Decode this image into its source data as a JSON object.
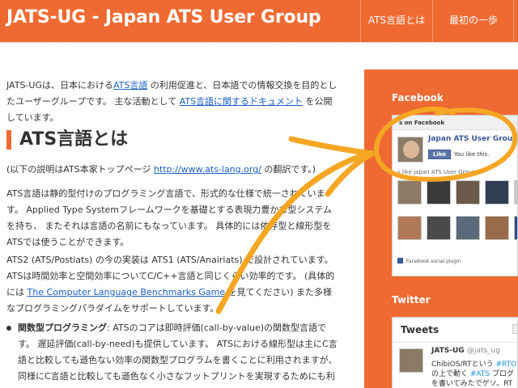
{
  "header": {
    "site_title": "JATS-UG - Japan ATS User Group",
    "nav": [
      {
        "label": "ATS言語とは"
      },
      {
        "label": "最初の一歩"
      }
    ]
  },
  "main": {
    "intro": {
      "t1": "JATS-UGは、日本における",
      "link1": "ATS言語",
      "t2": " の利用促進と、日本語での情報交換を目的としたユーザーグループです。 主な活動として ",
      "link2": "ATS言語に関するドキュメント",
      "t3": " を公開しています。"
    },
    "section_title": "ATS言語とは",
    "note": {
      "t1": "(以下の説明はATS本家トップページ ",
      "link": "http://www.ats-lang.org/",
      "t2": " の翻訳です。)"
    },
    "para1": "ATS言語は静的型付けのプログラミング言語で、形式的な仕様で統一されています。 Applied Type Systemフレームワークを基礎とする表現力豊かな型システムを持ち、 またそれは言語の名前にもなっています。 具体的には依存型と線形型をATSでは使うことができます。",
    "para2": {
      "t1": "ATS2 (ATS/Postiats) の今の実装は ATS1 (ATS/Anairiats) で設計されています。ATSは時間効率と空間効率についてC/C++言語と同じくらい効率的です。 (具体的には ",
      "link": "The Computer Language Benchmarks Game",
      "t2": " を見てください) また多様なプログラミングパラダイムをサポートしています。"
    },
    "bullet1": {
      "bold": "関数型プログラミング",
      "t1": ": ATSのコアは即時評価(call-by-value)の関数型言語です。 遅延評価(call-by-need)も提供しています。 ATSにおける線形型は主にC言語と比較しても遜色ない効率の関数型プログラムを書くことに利用されますが、同様にC言語と比較しても遜色なく小さなフットプリントを実現するためにも利用されます。"
    }
  },
  "sidebar": {
    "facebook": {
      "heading": "Facebook",
      "top_bar": "s on Facebook",
      "page_name": "Japan ATS User Group",
      "like_button": "Like",
      "like_text": "You like this.",
      "count_text": "s like Japan ATS User Group",
      "plugin_label": "Facebook social plugin",
      "faces": [
        {
          "label": "",
          "color": "#8c7a66"
        },
        {
          "label": "",
          "color": "#3a3a3a"
        },
        {
          "label": "",
          "color": "#6b5a4a"
        },
        {
          "label": "",
          "color": "#2f3e55"
        },
        {
          "label": "",
          "color": "#c8c8c8"
        },
        {
          "label": "",
          "color": "#b07a5a"
        },
        {
          "label": "",
          "color": "#4a4a4a"
        },
        {
          "label": "",
          "color": "#5a6a7a"
        },
        {
          "label": "",
          "color": "#9a6a4a"
        },
        {
          "label": "",
          "color": "#2a4a8a"
        }
      ]
    },
    "twitter": {
      "heading": "Twitter",
      "title": "Tweets",
      "user": "JATS-UG",
      "handle": "@jats_ug",
      "line1_a": "ChibiOS/RTという ",
      "line1_hash": "#RTO",
      "line2_a": "の上で動く ",
      "line2_hash": "#ATS",
      "line2_b": " プログ",
      "line3": "を書いてみたでゲソ。RT"
    }
  },
  "colors": {
    "brand": "#ef6a32",
    "link": "#1a5fc4",
    "annotation": "#f5a623"
  }
}
